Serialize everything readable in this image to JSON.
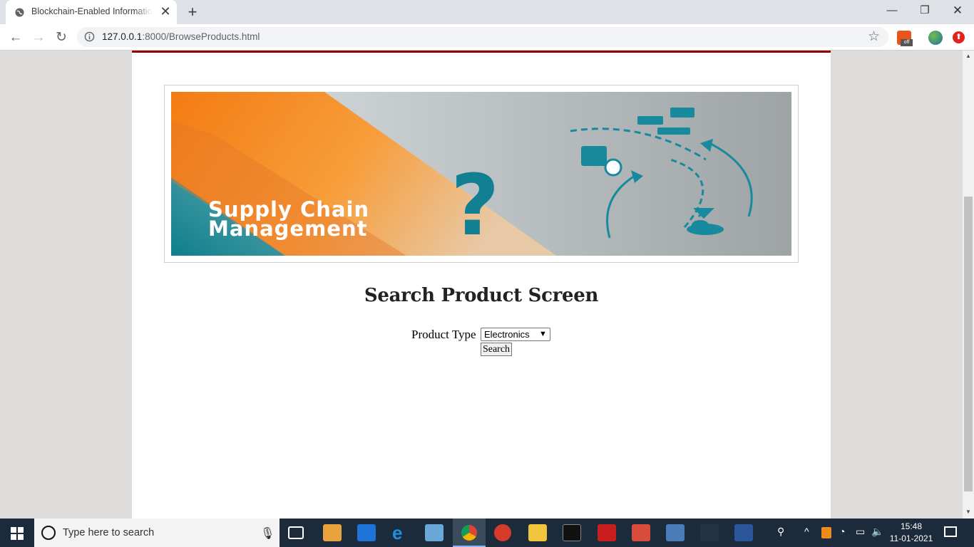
{
  "browser": {
    "tab_title": "Blockchain-Enabled Information",
    "new_tab_symbol": "+",
    "url_host": "127.0.0.1",
    "url_rest": ":8000/BrowseProducts.html"
  },
  "banner": {
    "text_line1": "Supply Chain",
    "text_line2": "Management",
    "question_mark": "?"
  },
  "page": {
    "heading": "Search Product Screen",
    "product_type_label": "Product Type",
    "product_type_selected": "Electronics",
    "search_button": "Search"
  },
  "taskbar": {
    "search_placeholder": "Type here to search",
    "time": "15:48",
    "date": "11-01-2021"
  },
  "colors": {
    "accent_line": "#8b0000",
    "banner_orange": "#f7901e",
    "banner_teal": "#137f92"
  }
}
